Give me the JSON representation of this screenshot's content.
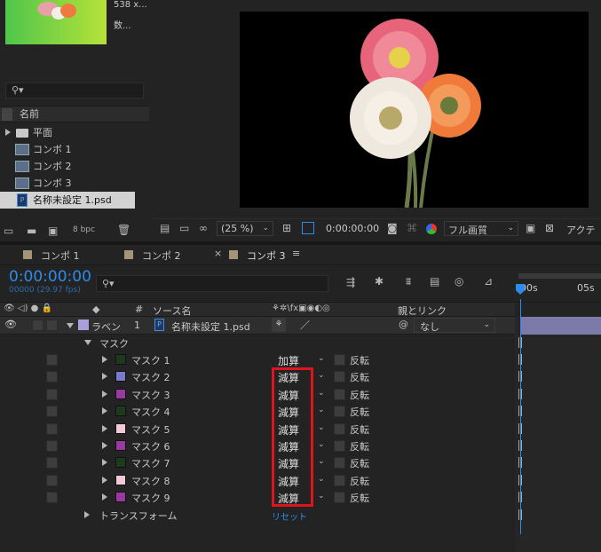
{
  "project": {
    "thumb_info_1": "538 x...",
    "thumb_info_2": "数...",
    "search_placeholder": "",
    "col_name": "名前",
    "items": [
      {
        "label": "平面",
        "type": "folder"
      },
      {
        "label": "コンボ 1",
        "type": "comp"
      },
      {
        "label": "コンボ 2",
        "type": "comp"
      },
      {
        "label": "コンボ 3",
        "type": "comp"
      },
      {
        "label": "名称未設定 1.psd",
        "type": "psd"
      }
    ],
    "bpc": "8 bpc"
  },
  "viewer": {
    "zoom": "(25 %)",
    "timecode": "0:00:00:00",
    "quality": "フル画質",
    "active": "アクティ"
  },
  "tabs": [
    {
      "label": "コンポ 1"
    },
    {
      "label": "コンポ 2"
    },
    {
      "label": "コンポ 3"
    }
  ],
  "timeline": {
    "timecode": "0:00:00:00",
    "fps": "00000 (29.97 fps)",
    "ruler_0": "00s",
    "ruler_5": "05s",
    "col_source": "ソース名",
    "col_parent": "親とリンク",
    "col_hash": "#",
    "layer": {
      "color_label": "ラベン",
      "index": "1",
      "name": "名称未設定 1.psd",
      "parent": "なし"
    },
    "mask_group": "マスク",
    "masks": [
      {
        "name": "マスク 1",
        "mode": "加算",
        "color": "#1e3a1e"
      },
      {
        "name": "マスク 2",
        "mode": "減算",
        "color": "#7a7ad0"
      },
      {
        "name": "マスク 3",
        "mode": "減算",
        "color": "#9a3aa0"
      },
      {
        "name": "マスク 4",
        "mode": "減算",
        "color": "#1e3a1e"
      },
      {
        "name": "マスク 5",
        "mode": "減算",
        "color": "#f0c8d8"
      },
      {
        "name": "マスク 6",
        "mode": "減算",
        "color": "#9a3aa0"
      },
      {
        "name": "マスク 7",
        "mode": "減算",
        "color": "#1e3a1e"
      },
      {
        "name": "マスク 8",
        "mode": "減算",
        "color": "#f0c8d8"
      },
      {
        "name": "マスク 9",
        "mode": "減算",
        "color": "#9a3aa0"
      }
    ],
    "invert_label": "反転",
    "transform": "トランスフォーム",
    "reset": "リセット"
  },
  "colors": {
    "accent_blue": "#2d8ceb",
    "highlight_red": "#e0141e"
  }
}
